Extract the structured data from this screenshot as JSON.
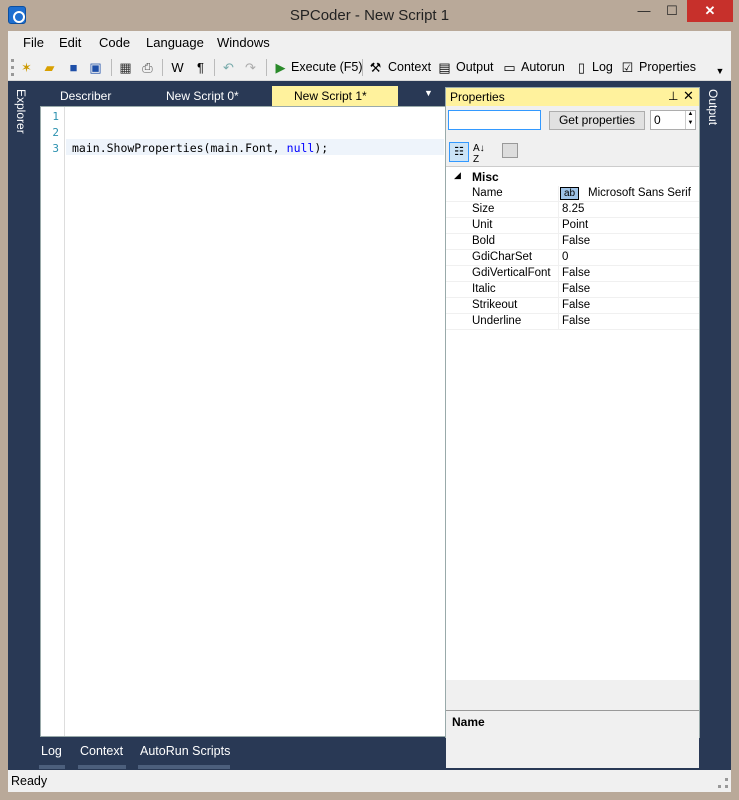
{
  "window": {
    "title": "SPCoder - New Script 1",
    "min_glyph": "—",
    "max_glyph": "☐",
    "close_glyph": "✕"
  },
  "menu": [
    "File",
    "Edit",
    "Code",
    "Language",
    "Windows"
  ],
  "toolbar": {
    "bold_w": "W",
    "pilcrow": "¶",
    "execute": "Execute (F5)",
    "context": "Context",
    "output": "Output",
    "autorun": "Autorun",
    "log": "Log",
    "properties": "Properties"
  },
  "side": {
    "left": "Explorer",
    "right": "Output"
  },
  "doc_tabs": [
    "Describer",
    "New Script 0*",
    "New Script 1*"
  ],
  "editor": {
    "line_numbers": [
      "1",
      "2",
      "3"
    ],
    "code": {
      "prefix": "main.ShowProperties(main.Font, ",
      "keyword": "null",
      "suffix": ");"
    }
  },
  "properties_pane": {
    "title": "Properties",
    "search_value": "",
    "get_button": "Get properties",
    "depth": "0",
    "category": "Misc",
    "font_preview": "ab",
    "rows": [
      {
        "name": "Name",
        "value": "Microsoft Sans Serif"
      },
      {
        "name": "Size",
        "value": "8.25"
      },
      {
        "name": "Unit",
        "value": "Point"
      },
      {
        "name": "Bold",
        "value": "False"
      },
      {
        "name": "GdiCharSet",
        "value": "0"
      },
      {
        "name": "GdiVerticalFont",
        "value": "False"
      },
      {
        "name": "Italic",
        "value": "False"
      },
      {
        "name": "Strikeout",
        "value": "False"
      },
      {
        "name": "Underline",
        "value": "False"
      }
    ],
    "help_title": "Name"
  },
  "bottom_tabs": [
    "Log",
    "Context",
    "AutoRun Scripts"
  ],
  "status": "Ready"
}
